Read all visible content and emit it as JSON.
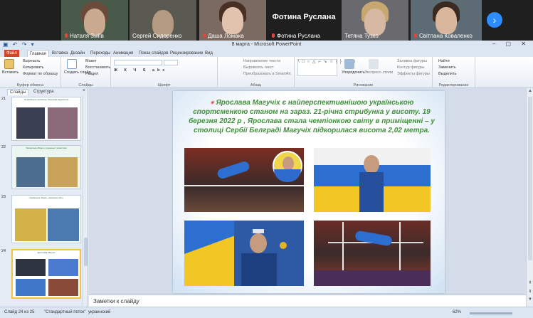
{
  "participants": [
    {
      "name": "Наталя Зміїв",
      "muted": true
    },
    {
      "name": "Сергей Сидоренко",
      "muted": false
    },
    {
      "name": "Даша Ломака",
      "muted": true
    },
    {
      "name": "Фотина Руслана",
      "muted": true,
      "big_name": "Фотина Руслана"
    },
    {
      "name": "Тетяна Тузко",
      "muted": false
    },
    {
      "name": "Світлана Коваленко",
      "muted": true
    }
  ],
  "next_page_icon": "chevron-right-icon",
  "window": {
    "title": "8 марта - Microsoft PowerPoint"
  },
  "tabs": [
    "Файл",
    "Главная",
    "Вставка",
    "Дизайн",
    "Переходы",
    "Анимация",
    "Показ слайдов",
    "Рецензирование",
    "Вид"
  ],
  "ribbon": {
    "paste": "Вставить",
    "cut": "Вырезать",
    "copy": "Копировать",
    "format_painter": "Формат по образцу",
    "clipboard": "Буфер обмена",
    "create_slide": "Создать слайд",
    "layout": "Макет",
    "reset": "Восстановить",
    "section": "Раздел",
    "slides": "Слайды",
    "font": "Шрифт",
    "text_direction": "Направление текста",
    "align_text": "Выровнять текст",
    "smartart": "Преобразовать в SmartArt",
    "paragraph": "Абзац",
    "arrange": "Упорядочить",
    "quick_styles": "Экспресс-стили",
    "shape_fill": "Заливка фигуры",
    "shape_outline": "Контур фигуры",
    "shape_effects": "Эффекты фигуры",
    "drawing": "Рисование",
    "find": "Найти",
    "replace": "Заменить",
    "select": "Выделить",
    "editing": "Редактирование"
  },
  "side_panel": {
    "tab_slides": "Слайды",
    "tab_outline": "Структура",
    "close": "×",
    "thumbnails": [
      {
        "num": "21",
        "text": "Олімпійська чемпіонка, бронзова медалістка"
      },
      {
        "num": "22",
        "text": "Українська збірна з художньої гімнастики"
      },
      {
        "num": "23",
        "text": "Українська збірна, чемпіонки світу"
      },
      {
        "num": "24",
        "text": "Ярослава Магучіх"
      }
    ]
  },
  "slide": {
    "text": "Ярослава Магучіх є найперспективнішою українською спортсменкою станом на зараз. 21-річна стрибунка у висоту. 19 березня  2022 р , Ярослава стала чемпіонкою світу в приміщенні – у столиці Сербії Белграді Магучіх підкорилася висота 2,02 метра."
  },
  "notes": {
    "placeholder": "Заметки к слайду"
  },
  "status": {
    "slide_info": "Слайд 24 из 25",
    "theme": "\"Стандартный поток\"",
    "language": "украинский",
    "zoom": "62%"
  }
}
